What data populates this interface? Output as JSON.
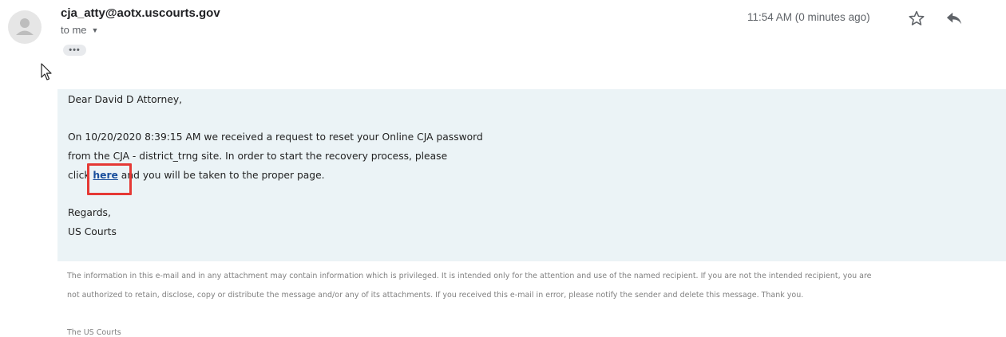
{
  "header": {
    "sender": "cja_atty@aotx.uscourts.gov",
    "recipient": "to me",
    "timestamp": "11:54 AM (0 minutes ago)"
  },
  "message": {
    "greeting": "Dear David D Attorney,",
    "para1_line1": "On 10/20/2020 8:39:15 AM we received a request to reset your Online CJA password",
    "para1_line2": "from the CJA - district_trng site. In order to start the recovery process, please",
    "para1_line3_before": "click ",
    "link_text": "here",
    "para1_line3_after": " and you will be taken to the proper page.",
    "closing": "Regards,",
    "signature": "US Courts"
  },
  "footer": {
    "disclaimer_line1": "The information in this e-mail and in any attachment may contain information which is privileged. It is intended only for the attention and use of the named recipient. If you are not the intended recipient, you are",
    "disclaimer_line2": "not authorized to retain, disclose, copy or distribute the message and/or any of its attachments. If you received this e-mail in error, please notify the sender and delete this message. Thank you.",
    "sign_off": "The US Courts"
  },
  "colors": {
    "highlight": "#e53935",
    "link": "#1a4f9c",
    "message_bg": "#ebf3f6"
  }
}
